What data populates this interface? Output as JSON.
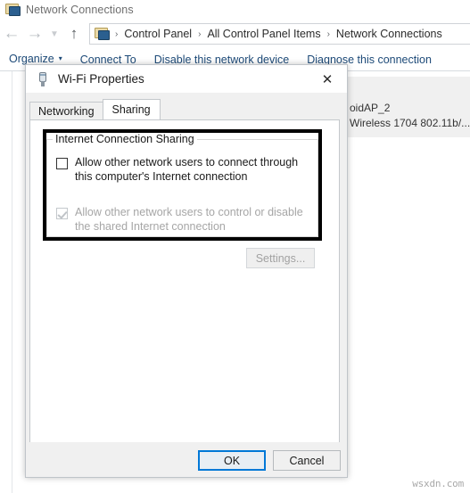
{
  "window": {
    "title": "Network Connections",
    "title_icon": "network-connections-icon"
  },
  "nav": {
    "back_icon": "arrow-left-icon",
    "forward_icon": "arrow-right-icon",
    "history_icon": "chevron-down-icon",
    "up_icon": "arrow-up-icon",
    "address_icon": "network-connections-icon",
    "breadcrumbs": [
      "Control Panel",
      "All Control Panel Items",
      "Network Connections"
    ],
    "separator": "›"
  },
  "command_bar": {
    "items": [
      {
        "label": "Organize",
        "has_caret": true,
        "caret": "▾"
      },
      {
        "label": "Connect To",
        "has_caret": false
      },
      {
        "label": "Disable this network device",
        "has_caret": false
      },
      {
        "label": "Diagnose this connection",
        "has_caret": false
      }
    ]
  },
  "connection_tile": {
    "name": "oidAP_2",
    "adapter": "Wireless 1704 802.11b/..."
  },
  "watermark": {
    "text": "wsxdn.com"
  },
  "dialog": {
    "title": "Wi-Fi Properties",
    "title_icon": "network-adapter-icon",
    "close_label": "✕",
    "tabs": [
      {
        "label": "Networking",
        "active": false
      },
      {
        "label": "Sharing",
        "active": true
      }
    ],
    "group": {
      "legend": "Internet Connection Sharing",
      "checkboxes": [
        {
          "label": "Allow other network users to connect through this computer's Internet connection",
          "checked": false,
          "disabled": false
        },
        {
          "label": "Allow other network users to control or disable the shared Internet connection",
          "checked": true,
          "disabled": true
        }
      ]
    },
    "settings_button": {
      "label": "Settings...",
      "disabled": true
    },
    "footer": {
      "ok_label": "OK",
      "cancel_label": "Cancel"
    }
  },
  "colors": {
    "accent": "#0078d7",
    "breadcrumb_link": "#1d4a78",
    "dialog_bg": "#f0f0f0",
    "highlight_border": "#000000",
    "disabled_text": "#a6a6a6"
  }
}
